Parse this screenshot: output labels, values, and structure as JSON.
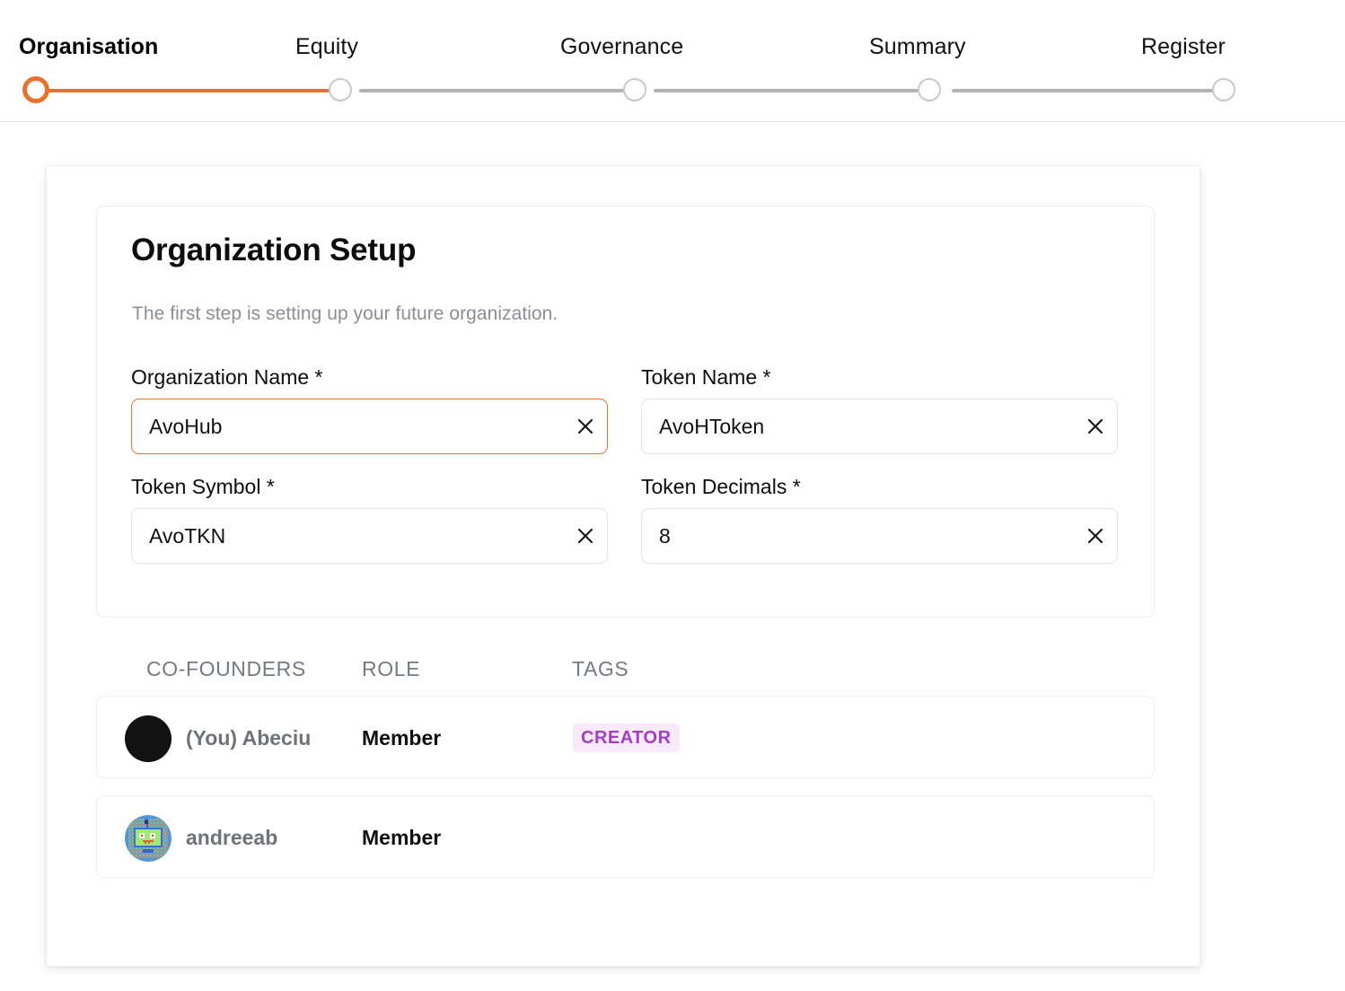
{
  "stepper": {
    "steps": [
      {
        "label": "Organisation",
        "state": "active"
      },
      {
        "label": "Equity",
        "state": "upcoming"
      },
      {
        "label": "Governance",
        "state": "upcoming"
      },
      {
        "label": "Summary",
        "state": "upcoming"
      },
      {
        "label": "Register",
        "state": "upcoming"
      }
    ],
    "accent_color": "#e8722c",
    "inactive_color": "#b3b3b3"
  },
  "card": {
    "title": "Organization Setup",
    "subtitle": "The first step is setting up your future organization."
  },
  "form": {
    "fields": [
      {
        "label": "Organization Name *",
        "value": "AvoHub",
        "placeholder": "Organization Name",
        "focused": true,
        "clear_icon": "close-icon"
      },
      {
        "label": "Token Name *",
        "value": "AvoHToken",
        "placeholder": "Token Name",
        "focused": false,
        "clear_icon": "close-icon"
      },
      {
        "label": "Token Symbol *",
        "value": "AvoTKN",
        "placeholder": "Token Symbol",
        "focused": false,
        "clear_icon": "close-icon"
      },
      {
        "label": "Token Decimals *",
        "value": "8",
        "placeholder": "Token Decimals",
        "focused": false,
        "clear_icon": "close-icon"
      }
    ]
  },
  "table": {
    "columns": {
      "founders": "CO-FOUNDERS",
      "role": "ROLE",
      "tags": "TAGS"
    },
    "rows": [
      {
        "name": "(You) Abeciu",
        "role": "Member",
        "tag": "CREATOR",
        "avatar_type": "solid-black",
        "tag_color": "#a23ec0",
        "tag_bg": "#f8eafb"
      },
      {
        "name": "andreeab",
        "role": "Member",
        "tag": "",
        "avatar_type": "robot-pixel",
        "tag_color": "",
        "tag_bg": ""
      }
    ]
  }
}
